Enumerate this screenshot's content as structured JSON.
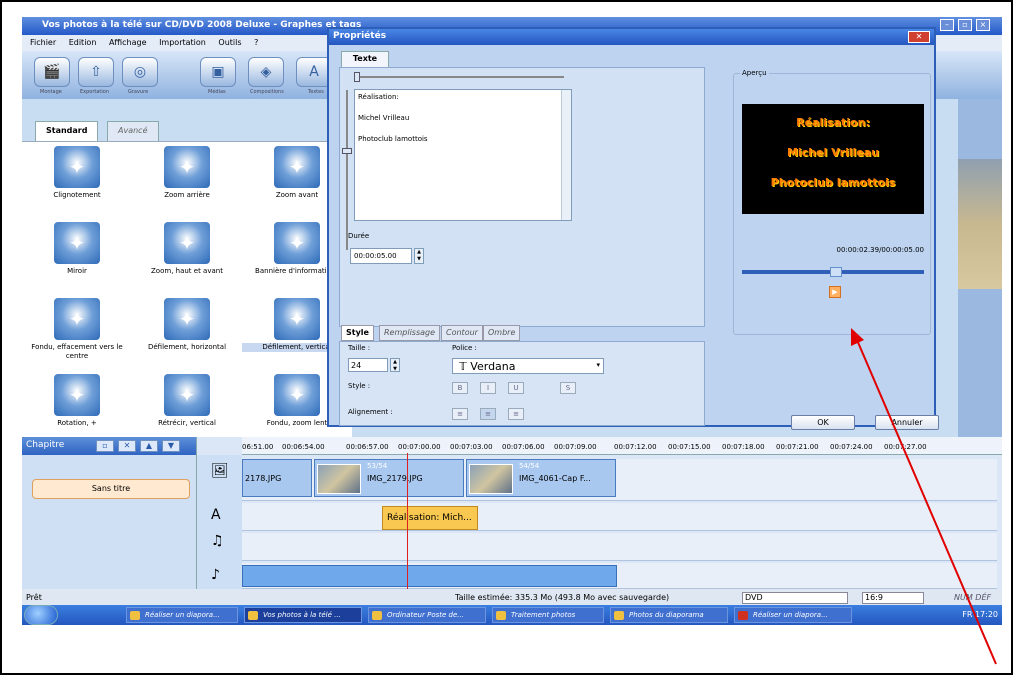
{
  "app": {
    "title": "Vos photos à la télé sur CD/DVD 2008 Deluxe - Graphes et tags"
  },
  "menu": [
    "Fichier",
    "Edition",
    "Affichage",
    "Importation",
    "Outils",
    "?"
  ],
  "toolbar": [
    "Montage",
    "Exportation",
    "Gravure",
    "Médias",
    "Compositions",
    "Textes"
  ],
  "effects_tabs": [
    "Standard",
    "Avancé"
  ],
  "effects": [
    "Clignotement",
    "Zoom arrière",
    "Zoom avant",
    "Miroir",
    "Zoom, haut et avant",
    "Bannière d'informations",
    "Fondu, effacement vers le centre",
    "Défilement, horizontal",
    "Défilement, vertical",
    "Rotation, +",
    "Rétrécir, vertical",
    "Fondu, zoom lent"
  ],
  "chapter": {
    "label": "Chapitre",
    "item": "Sans titre"
  },
  "ruler": [
    "06:51.00",
    "00:06:54.00",
    "00:06:57.00",
    "00:07:00.00",
    "00:07:03.00",
    "00:07:06.00",
    "00:07:09.00",
    "00:07:12.00",
    "00:07:15.00",
    "00:07:18.00",
    "00:07:21.00",
    "00:07:24.00",
    "00:07:27.00"
  ],
  "clips": [
    {
      "name": "2178.JPG",
      "num": ""
    },
    {
      "name": "IMG_2179.JPG",
      "num": "53/54"
    },
    {
      "name": "IMG_4061-Cap F...",
      "num": "54/54"
    }
  ],
  "text_clip": "Réalisation: Mich...",
  "status": {
    "left": "Prêt",
    "size": "Taille estimée: 335.3 Mo (493.8 Mo avec sauvegarde)",
    "format": "DVD",
    "ratio": "16:9",
    "indicators": "NUM DÉF"
  },
  "taskbar": [
    "Réaliser un diapora...",
    "Vos photos à la télé ...",
    "Ordinateur Poste de...",
    "Traitement photos",
    "Photos du diaporama",
    "Réaliser un diapora..."
  ],
  "tray": {
    "lang": "FR",
    "time": "17:20"
  },
  "dialog": {
    "title": "Propriétés",
    "tab": "Texte",
    "text_lines": [
      "Réalisation:",
      "Michel Vrilleau",
      "Photoclub lamottois"
    ],
    "duree_label": "Durée",
    "duree_value": "00:00:05.00",
    "style_tabs": [
      "Style",
      "Remplissage",
      "Contour",
      "Ombre"
    ],
    "taille_label": "Taille :",
    "taille_value": "24",
    "police_label": "Police :",
    "police_value": "Verdana",
    "style_label": "Style :",
    "align_label": "Alignement :",
    "apercu_label": "Aperçu",
    "timecode": "00:00:02.39/00:00:05.00",
    "ok": "OK",
    "cancel": "Annuler"
  },
  "colors": {
    "preview_text": "#ff7a00",
    "accent": "#2456c0",
    "arrow": "#e00000"
  }
}
